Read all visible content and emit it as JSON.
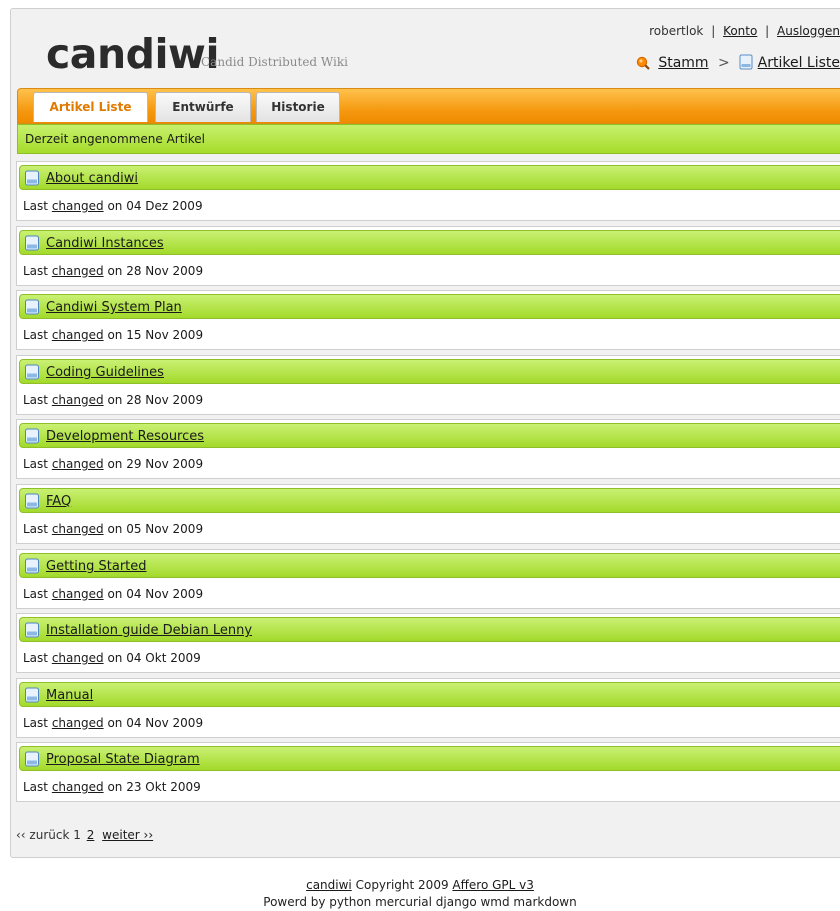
{
  "brand": {
    "name": "candiwi",
    "tagline": "Candid Distributed Wiki"
  },
  "userbar": {
    "username": "robertlok",
    "separator": "|",
    "account": "Konto",
    "logout": "Ausloggen"
  },
  "breadcrumb": {
    "root": "Stamm",
    "separator": ">",
    "current": "Artikel Liste"
  },
  "tabs": [
    {
      "label": "Artikel Liste",
      "active": true
    },
    {
      "label": "Entwürfe",
      "active": false
    },
    {
      "label": "Historie",
      "active": false
    }
  ],
  "subheader": "Derzeit angenommene Artikel",
  "item_meta": {
    "prefix": "Last",
    "link": "changed",
    "suffix": "on"
  },
  "articles": [
    {
      "title": "About candiwi",
      "date": "04 Dez 2009"
    },
    {
      "title": "Candiwi Instances",
      "date": "28 Nov 2009"
    },
    {
      "title": "Candiwi System Plan",
      "date": "15 Nov 2009"
    },
    {
      "title": "Coding Guidelines",
      "date": "28 Nov 2009"
    },
    {
      "title": "Development Resources",
      "date": "29 Nov 2009"
    },
    {
      "title": "FAQ",
      "date": "05 Nov 2009"
    },
    {
      "title": "Getting Started",
      "date": "04 Nov 2009"
    },
    {
      "title": "Installation guide Debian Lenny",
      "date": "04 Okt 2009"
    },
    {
      "title": "Manual",
      "date": "04 Nov 2009"
    },
    {
      "title": "Proposal State Diagram",
      "date": "23 Okt 2009"
    }
  ],
  "pagination": {
    "prev": "‹‹ zurück",
    "current": "1",
    "page2": "2",
    "next": "weiter ››"
  },
  "footer": {
    "line1": {
      "brand": "candiwi",
      "text": "Copyright 2009",
      "license": "Affero GPL v3"
    },
    "line2": "Powerd by python mercurial django wmd markdown"
  },
  "colors": {
    "orange": "#f59a12",
    "green": "#a6dc2a",
    "active_tab_text": "#e07b00"
  },
  "icons": {
    "search": "search-icon",
    "document": "document-icon"
  }
}
